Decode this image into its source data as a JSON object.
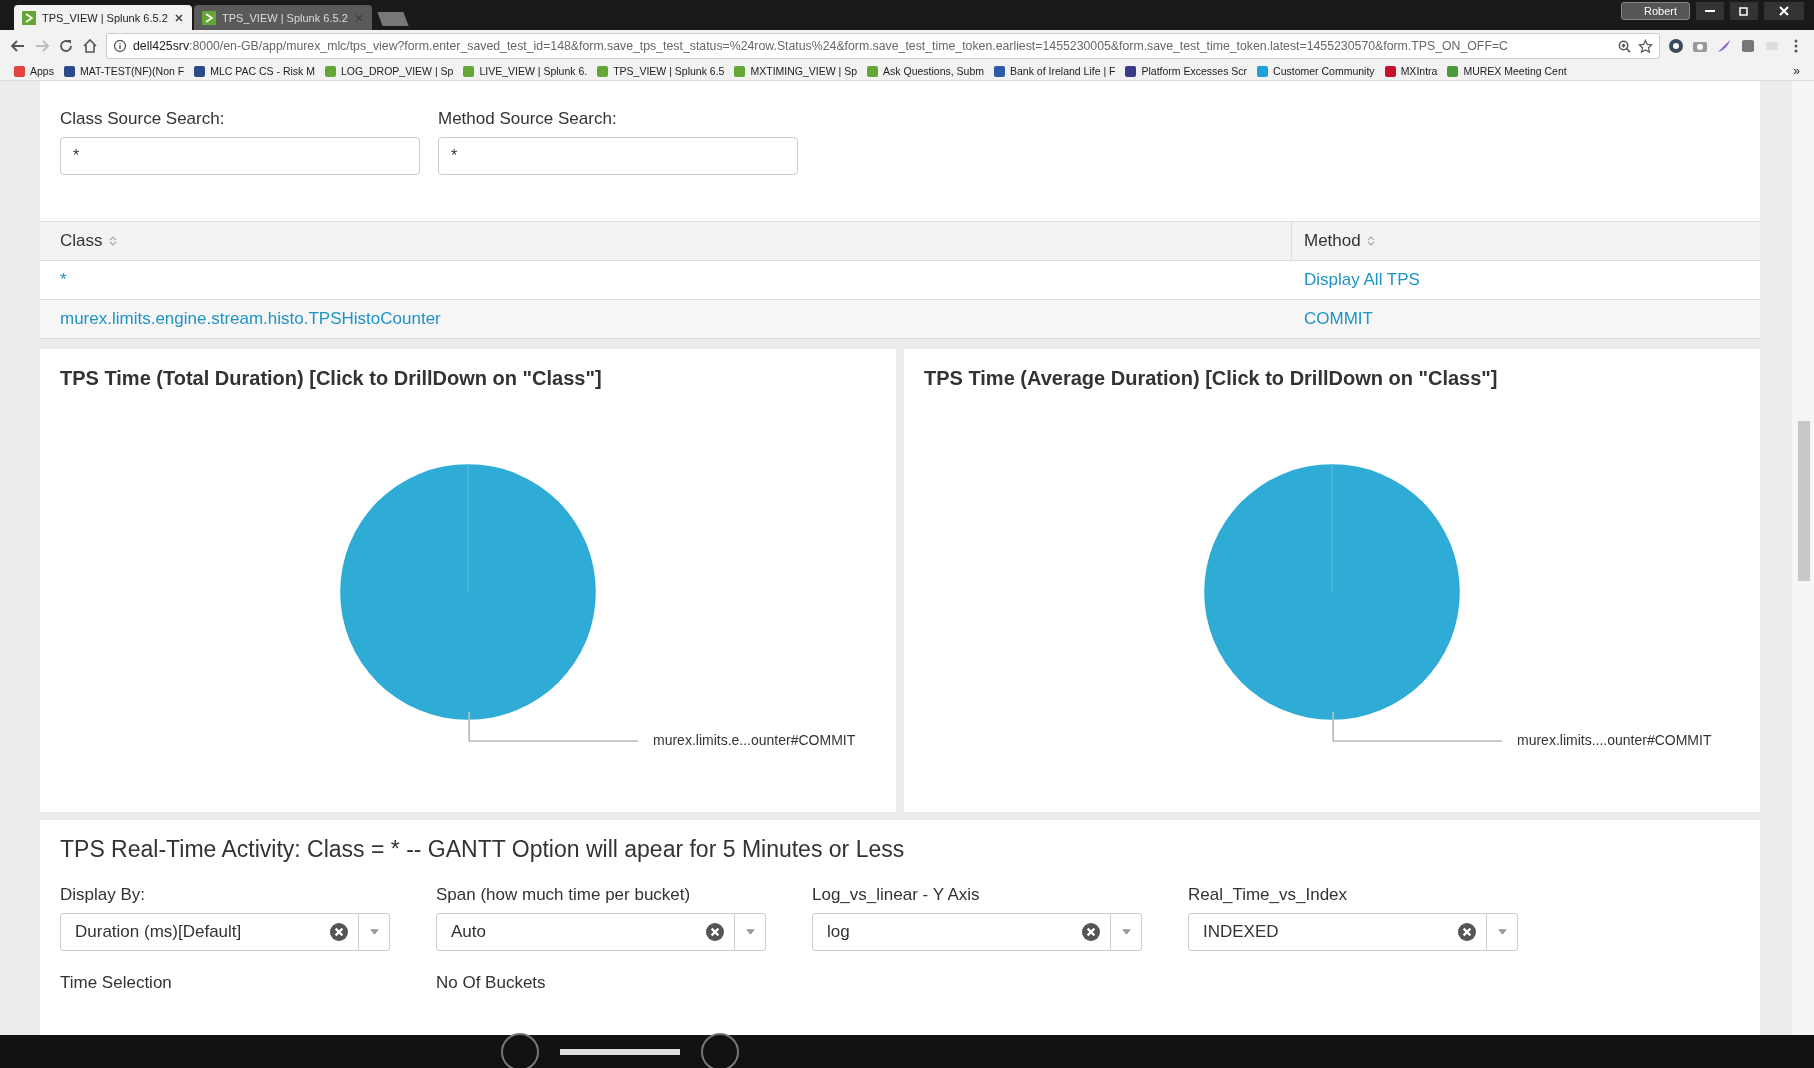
{
  "browser": {
    "tabs": [
      {
        "title": "TPS_VIEW | Splunk 6.5.2",
        "selected": true
      },
      {
        "title": "TPS_VIEW | Splunk 6.5.2",
        "selected": false
      }
    ],
    "profile": "Robert",
    "url_host": "dell425srv",
    "url_rest": ":8000/en-GB/app/murex_mlc/tps_view?form.enter_saved_test_id=148&form.save_tps_test_status=%24row.Status%24&form.save_test_time_token.earliest=1455230005&form.save_test_time_token.latest=1455230570&form.TPS_ON_OFF=C",
    "bookmarks": [
      {
        "kind": "apps",
        "label": "Apps"
      },
      {
        "kind": "cross",
        "label": "MAT-TEST(NF)(Non F"
      },
      {
        "kind": "cross",
        "label": "MLC PAC CS - Risk M"
      },
      {
        "kind": "splunk",
        "label": "LOG_DROP_VIEW | Sp"
      },
      {
        "kind": "splunk",
        "label": "LIVE_VIEW | Splunk 6."
      },
      {
        "kind": "splunk",
        "label": "TPS_VIEW | Splunk 6.5"
      },
      {
        "kind": "splunk",
        "label": "MXTIMING_VIEW | Sp"
      },
      {
        "kind": "splunk",
        "label": "Ask Questions, Subm"
      },
      {
        "kind": "stack",
        "label": "Bank of Ireland Life | F"
      },
      {
        "kind": "person",
        "label": "Platform Excesses Scr"
      },
      {
        "kind": "cloud",
        "label": "Customer Community"
      },
      {
        "kind": "mx",
        "label": "MXIntra"
      },
      {
        "kind": "globe",
        "label": "MUREX Meeting Cent"
      }
    ],
    "more": "»"
  },
  "search": {
    "fields": [
      {
        "label": "Class Source Search:",
        "value": "*"
      },
      {
        "label": "Method Source Search:",
        "value": "*"
      }
    ]
  },
  "table": {
    "columns": [
      "Class",
      "Method"
    ],
    "rows": [
      {
        "class": "*",
        "method": "Display All TPS"
      },
      {
        "class": "murex.limits.engine.stream.histo.TPSHistoCounter",
        "method": "COMMIT"
      }
    ]
  },
  "charts": [
    {
      "title": "TPS Time (Total Duration) [Click to DrillDown on \"Class\"]",
      "slice_label": "murex.limits.e...ounter#COMMIT"
    },
    {
      "title": "TPS Time (Average Duration) [Click to DrillDown on \"Class\"]",
      "slice_label": "murex.limits....ounter#COMMIT"
    }
  ],
  "realtime": {
    "title": "TPS Real-Time Activity: Class = * -- GANTT Option will apear for 5 Minutes or Less",
    "dropdowns": [
      {
        "label": "Display By:",
        "value": "Duration (ms)[Default]"
      },
      {
        "label": "Span (how much time per bucket)",
        "value": "Auto"
      },
      {
        "label": "Log_vs_linear - Y Axis",
        "value": "log"
      },
      {
        "label": "Real_Time_vs_Index",
        "value": "INDEXED"
      }
    ],
    "more_labels": [
      "Time Selection",
      "No Of Buckets"
    ]
  }
}
